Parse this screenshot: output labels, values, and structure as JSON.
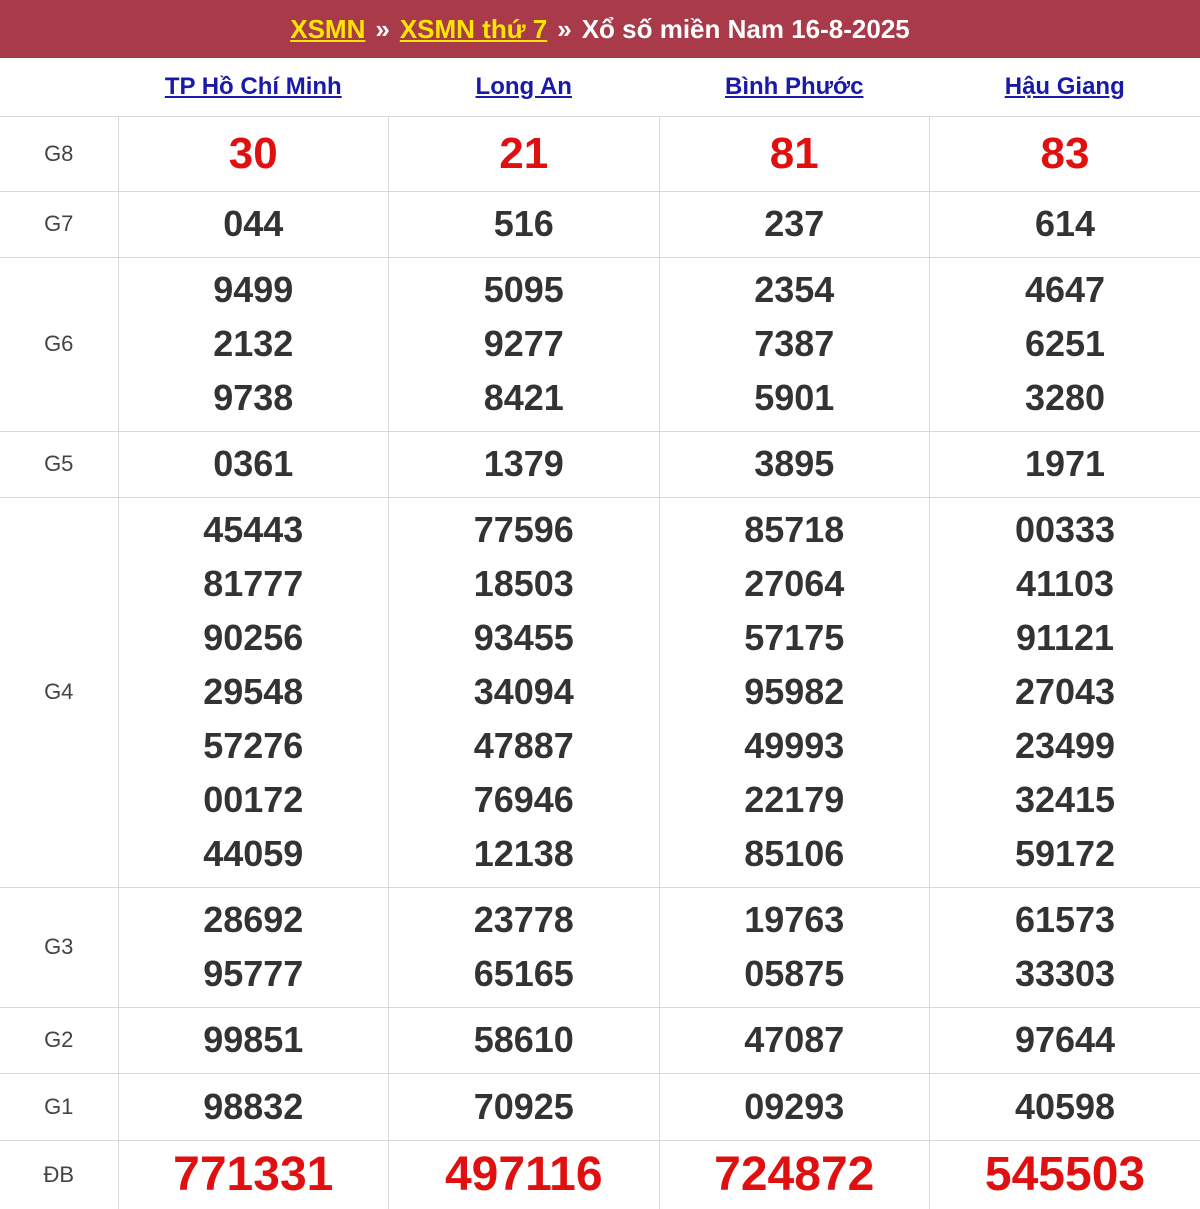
{
  "header": {
    "link1": "XSMN",
    "sep1": "»",
    "link2": "XSMN thứ 7",
    "sep2": "»",
    "title": "Xổ số miền Nam 16-8-2025"
  },
  "provinces": [
    "TP Hồ Chí Minh",
    "Long An",
    "Bình Phước",
    "Hậu Giang"
  ],
  "prizes": [
    {
      "label": "G8",
      "values": [
        [
          "30"
        ],
        [
          "21"
        ],
        [
          "81"
        ],
        [
          "83"
        ]
      ]
    },
    {
      "label": "G7",
      "values": [
        [
          "044"
        ],
        [
          "516"
        ],
        [
          "237"
        ],
        [
          "614"
        ]
      ]
    },
    {
      "label": "G6",
      "values": [
        [
          "9499",
          "2132",
          "9738"
        ],
        [
          "5095",
          "9277",
          "8421"
        ],
        [
          "2354",
          "7387",
          "5901"
        ],
        [
          "4647",
          "6251",
          "3280"
        ]
      ]
    },
    {
      "label": "G5",
      "values": [
        [
          "0361"
        ],
        [
          "1379"
        ],
        [
          "3895"
        ],
        [
          "1971"
        ]
      ]
    },
    {
      "label": "G4",
      "values": [
        [
          "45443",
          "81777",
          "90256",
          "29548",
          "57276",
          "00172",
          "44059"
        ],
        [
          "77596",
          "18503",
          "93455",
          "34094",
          "47887",
          "76946",
          "12138"
        ],
        [
          "85718",
          "27064",
          "57175",
          "95982",
          "49993",
          "22179",
          "85106"
        ],
        [
          "00333",
          "41103",
          "91121",
          "27043",
          "23499",
          "32415",
          "59172"
        ]
      ]
    },
    {
      "label": "G3",
      "values": [
        [
          "28692",
          "95777"
        ],
        [
          "23778",
          "65165"
        ],
        [
          "19763",
          "05875"
        ],
        [
          "61573",
          "33303"
        ]
      ]
    },
    {
      "label": "G2",
      "values": [
        [
          "99851"
        ],
        [
          "58610"
        ],
        [
          "47087"
        ],
        [
          "97644"
        ]
      ]
    },
    {
      "label": "G1",
      "values": [
        [
          "98832"
        ],
        [
          "70925"
        ],
        [
          "09293"
        ],
        [
          "40598"
        ]
      ]
    },
    {
      "label": "ĐB",
      "values": [
        [
          "771331"
        ],
        [
          "497116"
        ],
        [
          "724872"
        ],
        [
          "545503"
        ]
      ]
    }
  ],
  "colors": {
    "header_bg": "#a83a4a",
    "header_link": "#ffe600",
    "province_link": "#1a1aa8",
    "highlight_red": "#e01010"
  }
}
